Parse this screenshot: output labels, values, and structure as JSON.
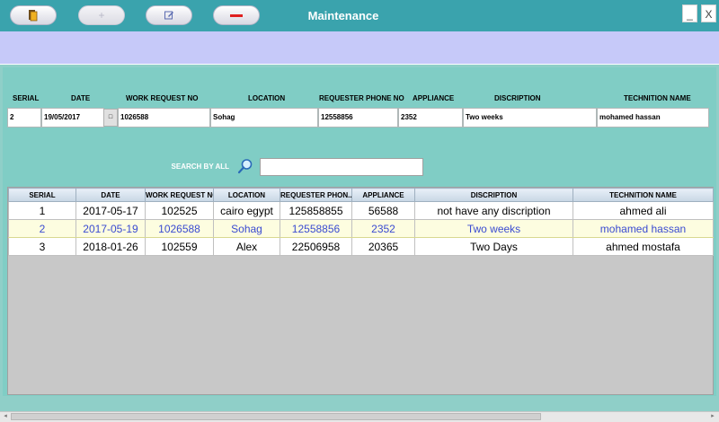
{
  "window": {
    "title": "Maintenance",
    "minimize_label": "_",
    "close_label": "X"
  },
  "toolbar": {
    "buttons": [
      {
        "name": "open-button",
        "icon": "folder-icon",
        "enabled": true
      },
      {
        "name": "add-button",
        "icon": "plus-icon",
        "symbol": "+",
        "enabled": false
      },
      {
        "name": "edit-button",
        "icon": "edit-icon",
        "enabled": true
      },
      {
        "name": "delete-button",
        "icon": "minus-icon",
        "enabled": true
      }
    ]
  },
  "form": {
    "headers": [
      "SERIAL",
      "DATE",
      "WORK REQUEST NO",
      "LOCATION",
      "REQUESTER PHONE NO",
      "APPLIANCE",
      "DISCRIPTION",
      "TECHNITION NAME"
    ],
    "values": {
      "serial": "2",
      "date": "19/05/2017",
      "work_request_no": "1026588",
      "location": "Sohag",
      "requester_phone_no": "12558856",
      "appliance": "2352",
      "discription": "Two weeks",
      "technition_name": "mohamed hassan"
    },
    "date_picker_glyph": "□"
  },
  "search": {
    "label": "SEARCH BY ALL",
    "value": "",
    "placeholder": ""
  },
  "grid": {
    "columns": [
      "SERIAL",
      "DATE",
      "WORK REQUEST NO",
      "LOCATION",
      "REQUESTER PHON...",
      "APPLIANCE",
      "DISCRIPTION",
      "TECHNITION NAME"
    ],
    "rows": [
      [
        "1",
        "2017-05-17",
        "102525",
        "cairo egypt",
        "125858855",
        "56588",
        "not have any discription",
        "ahmed ali"
      ],
      [
        "2",
        "2017-05-19",
        "1026588",
        "Sohag",
        "12558856",
        "2352",
        "Two weeks",
        "mohamed hassan"
      ],
      [
        "3",
        "2018-01-26",
        "102559",
        "Alex",
        "22506958",
        "20365",
        "Two Days",
        "ahmed mostafa"
      ]
    ],
    "selected_row": 1
  },
  "colors": {
    "titlebar": "#3aa3ad",
    "toolbar": "#c6c9f9",
    "panel": "#80cdc5",
    "selected_text": "#3a4bd1",
    "delete_red": "#e02020"
  }
}
